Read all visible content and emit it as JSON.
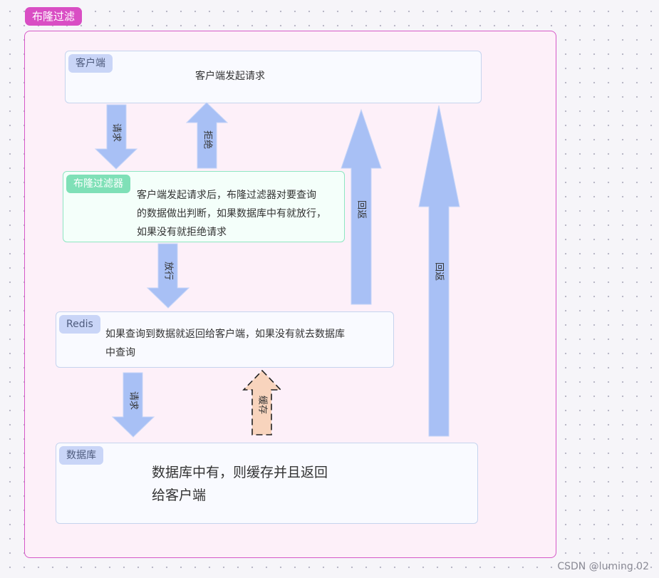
{
  "frame": {
    "title": "布隆过滤"
  },
  "client": {
    "tag": "客户端",
    "text": "客户端发起请求"
  },
  "filter": {
    "tag": "布隆过滤器",
    "lines": [
      "客户端发起请求后，布隆过滤器对要查询",
      "的数据做出判断，如果数据库中有就放行，",
      "如果没有就拒绝请求"
    ]
  },
  "redis": {
    "tag": "Redis",
    "lines": [
      "如果查询到数据就返回给客户端，如果没有就去数据库",
      "中查询"
    ]
  },
  "database": {
    "tag": "数据库",
    "lines": [
      "数据库中有，则缓存并且返回",
      "给客户端"
    ]
  },
  "arrows": {
    "request1": "请求",
    "reject": "拒绝",
    "pass": "放行",
    "return_from_redis": "回返",
    "return_from_db": "回返",
    "request2": "请求",
    "cache": "缓存"
  },
  "colors": {
    "frame": "#d94ec4",
    "arrow_fill": "#a8c0f5",
    "cache_fill": "#f8d4bd",
    "green": "#7fe0b7"
  },
  "watermark": "CSDN @luming.02"
}
